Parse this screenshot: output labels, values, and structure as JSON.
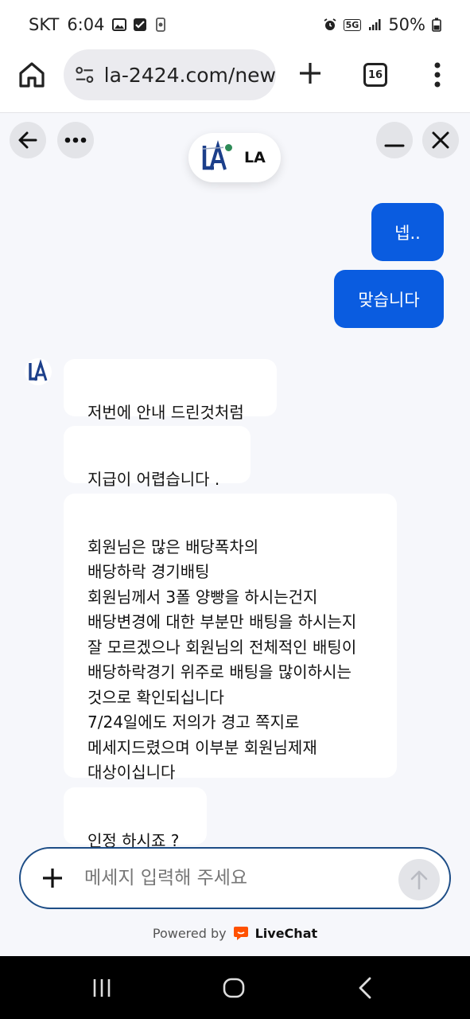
{
  "status_bar": {
    "carrier": "SKT",
    "time": "6:04",
    "network": "5G",
    "battery": "50%"
  },
  "browser": {
    "url": "la-2424.com/new",
    "tab_count": "16"
  },
  "chat": {
    "agent_name": "LA",
    "user_messages": [
      "넵..",
      "맞습니다"
    ],
    "agent_messages": [
      "저번에 안내 드린것처럼",
      "지급이 어렵습니다 .",
      "회원님은 많은 배당폭차의\n배당하락 경기배팅\n회원님께서 3폴 양빵을 하시는건지\n배당변경에 대한 부분만 배팅을 하시는지\n잘 모르겠으나 회원님의 전체적인 배팅이\n배당하락경기 위주로 배팅을 많이하시는\n것으로 확인되십니다\n7/24일에도 저의가 경고 쪽지로\n메세지드렸으며 이부분 회원님제재\n대상이십니다",
      "인정 하시죠 ?"
    ]
  },
  "composer": {
    "placeholder": "메세지 입력해 주세요"
  },
  "footer": {
    "powered_by": "Powered by",
    "brand": "LiveChat"
  },
  "colors": {
    "user_bubble": "#0a5ce0",
    "composer_border": "#1d4d86",
    "online": "#2e8b57",
    "livechat_orange": "#ff5100"
  }
}
